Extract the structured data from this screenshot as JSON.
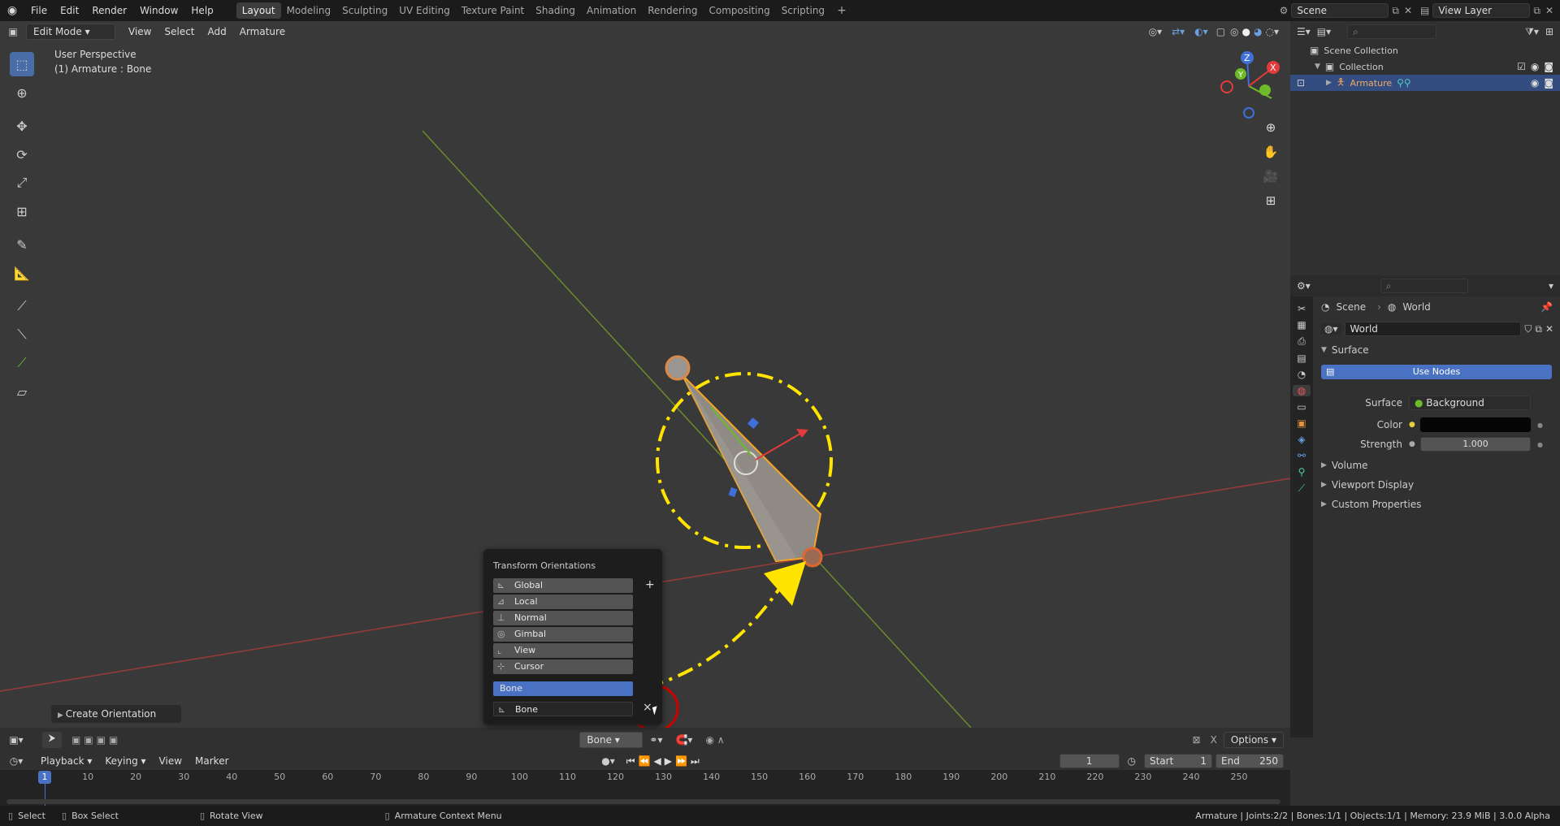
{
  "topbar": {
    "menus": [
      "File",
      "Edit",
      "Render",
      "Window",
      "Help"
    ],
    "workspaces": [
      "Layout",
      "Modeling",
      "Sculpting",
      "UV Editing",
      "Texture Paint",
      "Shading",
      "Animation",
      "Rendering",
      "Compositing",
      "Scripting"
    ],
    "active_workspace": "Layout",
    "scene": "Scene",
    "view_layer": "View Layer"
  },
  "viewport": {
    "mode": "Edit Mode",
    "menus": [
      "View",
      "Select",
      "Add",
      "Armature"
    ],
    "perspective": "User Perspective",
    "object_info": "(1) Armature : Bone",
    "redo_panel": "Create Orientation",
    "orientation_dropdown": "Bone",
    "options_label": "Options",
    "gizmo_axes": [
      "Z",
      "Y",
      "X"
    ]
  },
  "popup": {
    "title": "Transform Orientations",
    "items": [
      "Global",
      "Local",
      "Normal",
      "Gimbal",
      "View",
      "Cursor"
    ],
    "selected": "Bone",
    "name_field": "Bone",
    "add_label": "+",
    "remove_label": "×"
  },
  "outliner": {
    "root": "Scene Collection",
    "collection": "Collection",
    "object": "Armature"
  },
  "properties": {
    "breadcrumb_scene": "Scene",
    "breadcrumb_world": "World",
    "world_name": "World",
    "surface_panel": "Surface",
    "use_nodes": "Use Nodes",
    "surface_label": "Surface",
    "surface_value": "Background",
    "color_label": "Color",
    "strength_label": "Strength",
    "strength_value": "1.000",
    "panels": [
      "Volume",
      "Viewport Display",
      "Custom Properties"
    ]
  },
  "timeline": {
    "menus": [
      "Playback",
      "Keying",
      "View",
      "Marker"
    ],
    "current_frame": "1",
    "start_label": "Start",
    "start": "1",
    "end_label": "End",
    "end": "250",
    "ruler": [
      "10",
      "20",
      "30",
      "40",
      "50",
      "60",
      "70",
      "80",
      "90",
      "100",
      "110",
      "120",
      "130",
      "140",
      "150",
      "160",
      "170",
      "180",
      "190",
      "200",
      "210",
      "220",
      "230",
      "240",
      "250"
    ],
    "current_marker": "1"
  },
  "statusbar": {
    "select": "Select",
    "box_select": "Box Select",
    "rotate": "Rotate View",
    "context": "Armature Context Menu",
    "stats": "Armature | Joints:2/2 | Bones:1/1 | Objects:1/1 | Memory: 23.9 MiB | 3.0.0 Alpha"
  },
  "colors": {
    "accent": "#4a72c4",
    "annotation": "#ffe400",
    "highlight_circle": "#d00000"
  }
}
